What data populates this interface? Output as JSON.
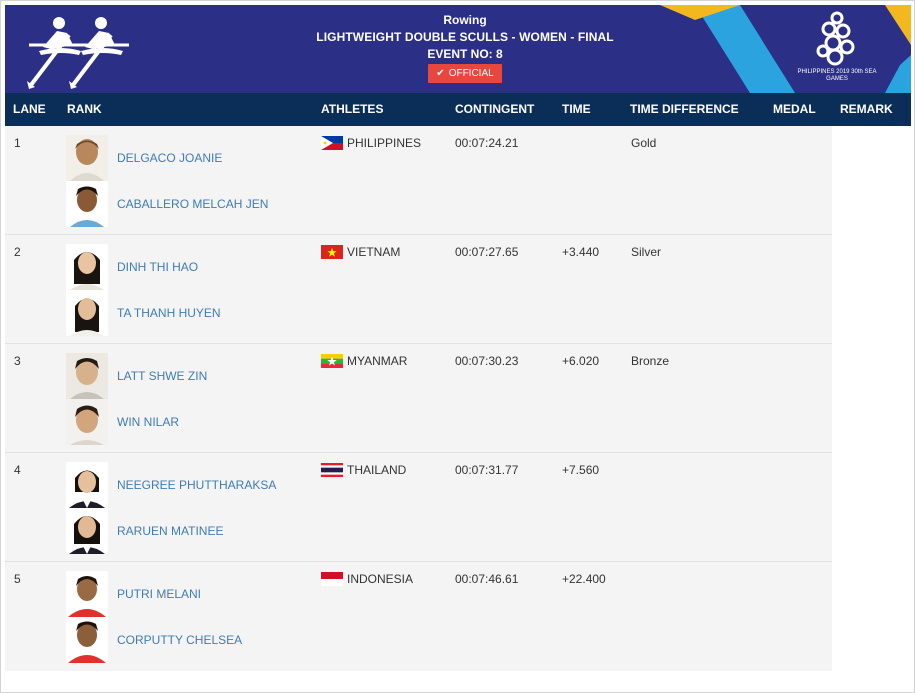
{
  "header": {
    "sport": "Rowing",
    "event_title": "LIGHTWEIGHT DOUBLE SCULLS - WOMEN - FINAL",
    "event_no": "EVENT NO: 8",
    "status_badge": "OFFICIAL",
    "games_logo_text": "PHILIPPINES 2019 30th SEA GAMES",
    "colors": {
      "banner": "#2b2f86",
      "accent_yellow": "#f3b81e",
      "accent_blue": "#2aa3df",
      "badge": "#e8473d"
    }
  },
  "columns": {
    "lane": "LANE",
    "rank": "RANK",
    "athletes": "ATHLETES",
    "contingent": "CONTINGENT",
    "time": "TIME",
    "time_difference": "TIME DIFFERENCE",
    "medal": "MEDAL",
    "remark": "REMARK"
  },
  "rows": [
    {
      "lane": "1",
      "country": "PHILIPPINES",
      "flag": "flag-philippines",
      "time": "00:07:24.21",
      "diff": "",
      "medal": "Gold",
      "athletes": [
        {
          "name": "DELGACO JOANIE"
        },
        {
          "name": "CABALLERO MELCAH JEN"
        }
      ]
    },
    {
      "lane": "2",
      "country": "VIETNAM",
      "flag": "flag-vietnam",
      "time": "00:07:27.65",
      "diff": "+3.440",
      "medal": "Silver",
      "athletes": [
        {
          "name": "DINH THI HAO"
        },
        {
          "name": "TA THANH HUYEN"
        }
      ]
    },
    {
      "lane": "3",
      "country": "MYANMAR",
      "flag": "flag-myanmar",
      "time": "00:07:30.23",
      "diff": "+6.020",
      "medal": "Bronze",
      "athletes": [
        {
          "name": "LATT SHWE ZIN"
        },
        {
          "name": "WIN NILAR"
        }
      ]
    },
    {
      "lane": "4",
      "country": "THAILAND",
      "flag": "flag-thailand",
      "time": "00:07:31.77",
      "diff": "+7.560",
      "medal": "",
      "athletes": [
        {
          "name": "NEEGREE PHUTTHARAKSA"
        },
        {
          "name": "RARUEN MATINEE"
        }
      ]
    },
    {
      "lane": "5",
      "country": "INDONESIA",
      "flag": "flag-indonesia",
      "time": "00:07:46.61",
      "diff": "+22.400",
      "medal": "",
      "athletes": [
        {
          "name": "PUTRI MELANI"
        },
        {
          "name": "CORPUTTY CHELSEA"
        }
      ]
    }
  ]
}
